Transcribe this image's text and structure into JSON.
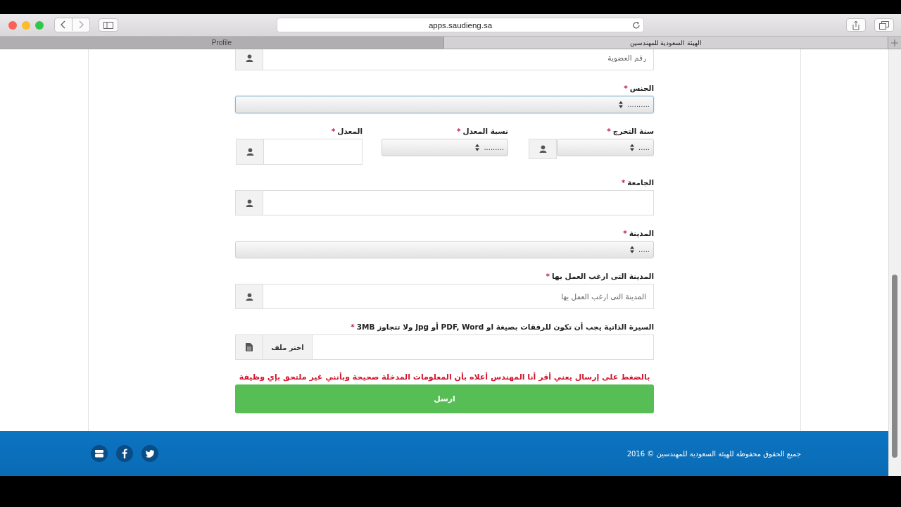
{
  "browser": {
    "url": "apps.saudieng.sa",
    "tabs": [
      {
        "label": "الهيئة السعودية للمهندسين",
        "selected": true
      },
      {
        "label": "Profile",
        "selected": false
      }
    ]
  },
  "form": {
    "fields": [
      {
        "kind": "input",
        "placeholder": "رقم العضوية"
      },
      {
        "kind": "select",
        "label": "الجنس",
        "required": "*",
        "value": "..........",
        "focused": true,
        "addon": false
      },
      {
        "kind": "row",
        "fields": [
          {
            "kind": "select",
            "label": "سنة التخرج",
            "required": "*",
            "value": ".....",
            "focused": false,
            "addon": true
          },
          {
            "kind": "select",
            "label": "نسبة المعدل",
            "required": "*",
            "value": ".........",
            "focused": false,
            "addon": false
          },
          {
            "kind": "input",
            "label": "المعدل",
            "required": "*"
          }
        ]
      },
      {
        "kind": "input",
        "label": "الجامعة",
        "required": "*"
      },
      {
        "kind": "select",
        "label": "المدينة",
        "required": "*",
        "value": ".....",
        "focused": false,
        "addon": false
      },
      {
        "kind": "input",
        "label": "المدينة التى ارغب العمل بها",
        "required": "*",
        "placeholder": "المدينة التى ارغب العمل بها"
      },
      {
        "kind": "file",
        "label": "السيرة الذاتية يجب أن تكون للرفقات بصيغة او PDF, Word أو Jpg ولا تتجاوز 3MB",
        "required": "*",
        "button": "اختر ملف"
      }
    ],
    "notice": "بالضغط على إرسال يعني أقر أنا المهندس أعلاه بأن المعلومات المدخلة صحيحة وبأنني غير ملتحق بإي وظيفة",
    "submit": "ارسل"
  },
  "footer": {
    "copyright": "جميع الحقوق محفوظة للهيئة السعودية للمهندسين © 2016"
  }
}
